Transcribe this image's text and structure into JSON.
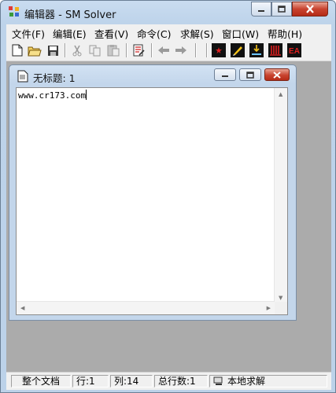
{
  "window": {
    "title": "编辑器 - SM Solver"
  },
  "menu": [
    {
      "label": "文件(F)"
    },
    {
      "label": "编辑(E)"
    },
    {
      "label": "查看(V)"
    },
    {
      "label": "命令(C)"
    },
    {
      "label": "求解(S)"
    },
    {
      "label": "窗口(W)"
    },
    {
      "label": "帮助(H)"
    }
  ],
  "toolbar": {
    "buttons": [
      "new-file-icon",
      "open-folder-icon",
      "save-icon",
      "cut-icon",
      "copy-icon",
      "paste-icon",
      "edit-document-icon",
      "back-arrow-icon",
      "forward-arrow-icon",
      "red-star-icon",
      "pencil-icon",
      "solve-icon",
      "bars-icon",
      "ea-icon"
    ],
    "ea_label": "EA"
  },
  "document": {
    "title": "无标题: 1",
    "content": "www.cr173.com"
  },
  "status": {
    "scope": "整个文档",
    "line": "行:1",
    "column": "列:14",
    "total_lines": "总行数:1",
    "solve_mode": "本地求解"
  },
  "colors": {
    "accent_red": "#cc0000",
    "toolbar_bg": "#f0f0f0",
    "mdi_bg": "#ababab"
  }
}
